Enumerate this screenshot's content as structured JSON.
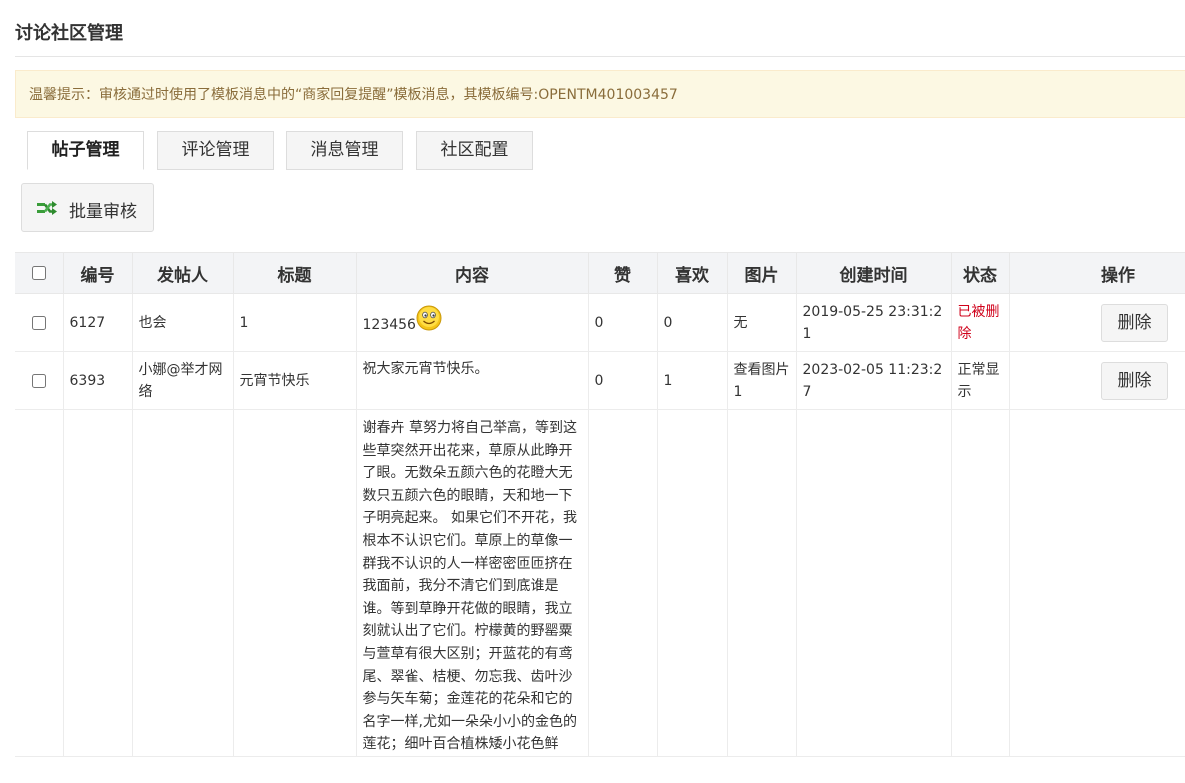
{
  "page": {
    "title": "讨论社区管理",
    "notice": "温馨提示：审核通过时使用了模板消息中的“商家回复提醒”模板消息，其模板编号:OPENTM401003457"
  },
  "tabs": [
    "帖子管理",
    "评论管理",
    "消息管理",
    "社区配置"
  ],
  "toolbar": {
    "batch_label": "批量审核",
    "batch_icon": "shuffle-arrows-icon"
  },
  "table": {
    "headers": [
      "编号",
      "发帖人",
      "标题",
      "内容",
      "赞",
      "喜欢",
      "图片",
      "创建时间",
      "状态",
      "操作"
    ],
    "rows": [
      {
        "id": "6127",
        "author": "也会",
        "title": "1",
        "content": "123456",
        "content_icon": "smiley-emoji-icon",
        "likes": "0",
        "favorites": "0",
        "image": "无",
        "created": "2019-05-25 23:31:21",
        "status": "已被删除",
        "action": "删除"
      },
      {
        "id": "6393",
        "author": "小娜@举才网络",
        "title": "元宵节快乐",
        "content": "祝大家元宵节快乐。",
        "likes": "0",
        "favorites": "1",
        "image": "查看图片1",
        "created": "2023-02-05 11:23:27",
        "status": "正常显示",
        "action": "删除"
      },
      {
        "id": "",
        "author": "",
        "title": "",
        "content": "谢春卉 草努力将自己举高，等到这些草突然开出花来，草原从此睁开了眼。无数朵五颜六色的花瞪大无数只五颜六色的眼睛，天和地一下子明亮起来。 如果它们不开花，我根本不认识它们。草原上的草像一群我不认识的人一样密密匝匝挤在我面前，我分不清它们到底谁是谁。等到草睁开花做的眼睛，我立刻就认出了它们。柠檬黄的野罂粟与萱草有很大区别；开蓝花的有鸢尾、翠雀、桔梗、勿忘我、齿叶沙参与矢车菊；金莲花的花朵和它的名字一样,尤如一朵朵小小的金色的莲花；细叶百合植株矮小花色鲜"
      }
    ]
  },
  "colors": {
    "notice_bg": "#fcf8e3",
    "notice_text": "#8a6d3b",
    "deleted_status": "#d0021b",
    "header_bg": "#f3f4f6"
  }
}
